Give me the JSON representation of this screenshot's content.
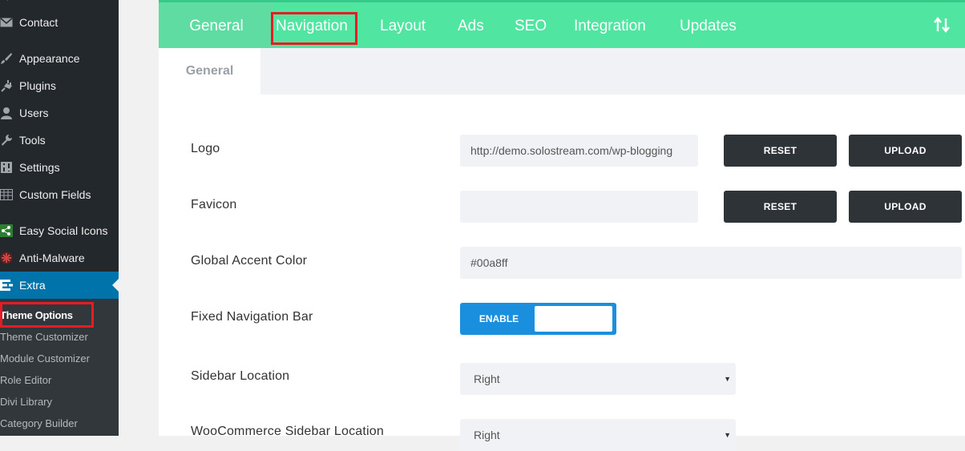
{
  "sidebar": {
    "items": [
      {
        "label": "Contact",
        "icon": "mail-icon"
      },
      {
        "label": "Appearance",
        "icon": "brush-icon"
      },
      {
        "label": "Plugins",
        "icon": "plug-icon"
      },
      {
        "label": "Users",
        "icon": "user-icon"
      },
      {
        "label": "Tools",
        "icon": "wrench-icon"
      },
      {
        "label": "Settings",
        "icon": "sliders-icon"
      },
      {
        "label": "Custom Fields",
        "icon": "table-icon"
      },
      {
        "label": "Easy Social Icons",
        "icon": "share-icon"
      },
      {
        "label": "Anti-Malware",
        "icon": "shield-icon"
      },
      {
        "label": "Extra",
        "icon": "extra-icon"
      }
    ],
    "submenu": [
      "Theme Options",
      "Theme Customizer",
      "Module Customizer",
      "Role Editor",
      "Divi Library",
      "Category Builder"
    ]
  },
  "tabs": [
    "General",
    "Navigation",
    "Layout",
    "Ads",
    "SEO",
    "Integration",
    "Updates"
  ],
  "subtab": "General",
  "fields": {
    "logo": {
      "label": "Logo",
      "value": "http://demo.solostream.com/wp-blogging"
    },
    "favicon": {
      "label": "Favicon",
      "value": ""
    },
    "accent": {
      "label": "Global Accent Color",
      "value": "#00a8ff"
    },
    "fixed_nav": {
      "label": "Fixed Navigation Bar",
      "toggle_label": "ENABLE"
    },
    "sidebar_location": {
      "label": "Sidebar Location",
      "value": "Right"
    },
    "woo_sidebar_location": {
      "label": "WooCommerce Sidebar Location",
      "value": "Right"
    }
  },
  "buttons": {
    "reset": "RESET",
    "upload": "UPLOAD"
  },
  "colors": {
    "sidebar_bg": "#23282d",
    "active_blue": "#0073aa",
    "tab_bar_green": "#50e5a0",
    "highlight_red": "#e51c23",
    "toggle_blue": "#1a8fde"
  }
}
